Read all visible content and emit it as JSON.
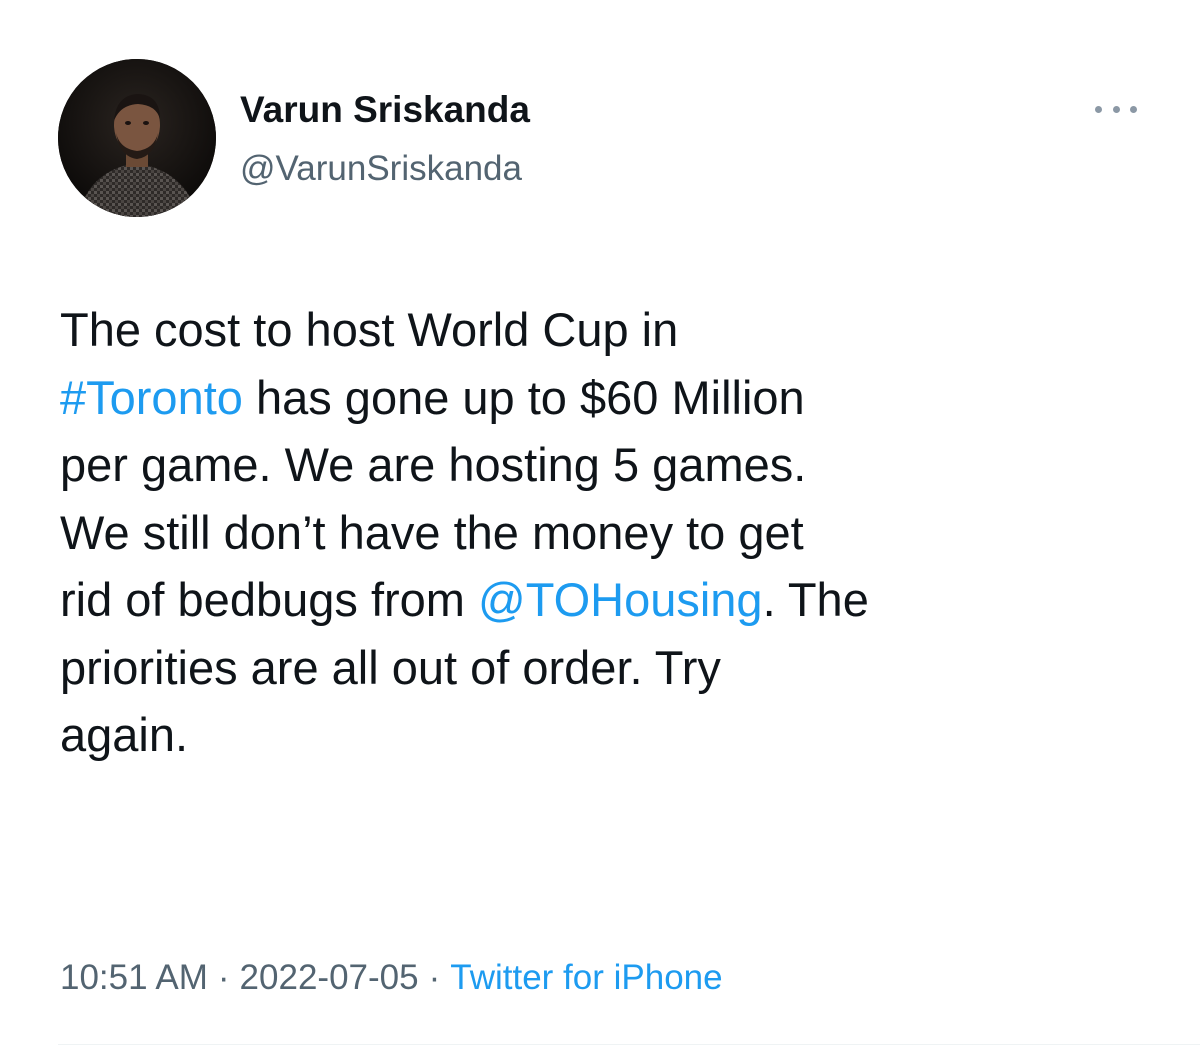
{
  "author": {
    "display_name": "Varun Sriskanda",
    "handle": "@VarunSriskanda"
  },
  "menu": {
    "icon": "more-horizontal-icon"
  },
  "tweet": {
    "line1": "The cost to host World Cup in",
    "line2_link": "#Toronto",
    "line2_rest": " has gone up to $60 Million",
    "line3": "per game. We are hosting 5 games.",
    "line4": "We still don’t have the money to get",
    "line5_pre": "rid of bedbugs from ",
    "line5_link": "@TOHousing",
    "line5_post": ". The",
    "line6": "priorities are all out of order. Try",
    "line7": "again."
  },
  "meta": {
    "time": "10:51 AM",
    "separator": "·",
    "date": "2022-07-05",
    "source": "Twitter for iPhone"
  },
  "colors": {
    "link": "#1d9bf0",
    "secondary_text": "#536471",
    "primary_text": "#0f1419"
  }
}
